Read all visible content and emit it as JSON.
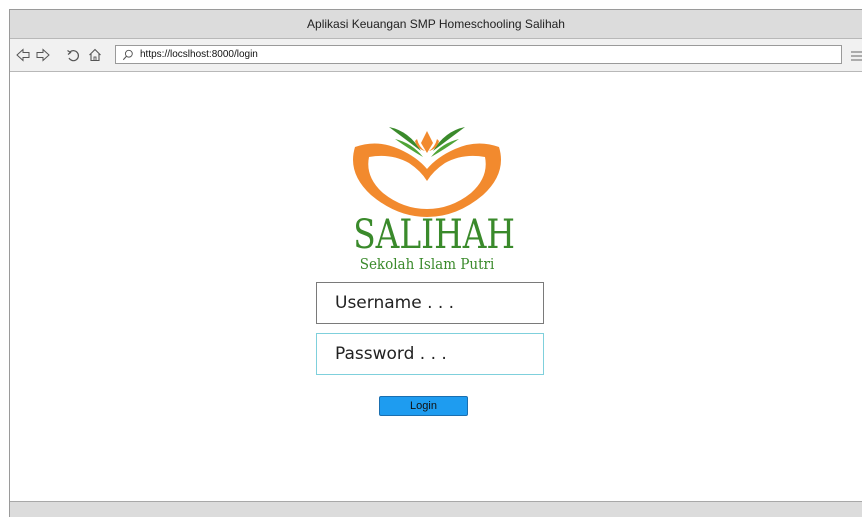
{
  "window": {
    "title": "Aplikasi Keuangan SMP Homeschooling Salihah"
  },
  "toolbar": {
    "back_icon": "arrow-left-icon",
    "forward_icon": "arrow-right-icon",
    "reload_icon": "reload-icon",
    "home_icon": "home-icon",
    "search_icon": "search-icon",
    "url": "https://locslhost:8000/login",
    "menu_icon": "hamburger-menu-icon"
  },
  "logo": {
    "title": "SALIHAH",
    "subtitle": "Sekolah Islam Putri",
    "colors": {
      "green": "#3a8a2b",
      "orange": "#f28a2e"
    }
  },
  "form": {
    "username_placeholder": "Username . . .",
    "password_placeholder": "Password . . .",
    "login_label": "Login",
    "accent": "#1e9cf0"
  }
}
